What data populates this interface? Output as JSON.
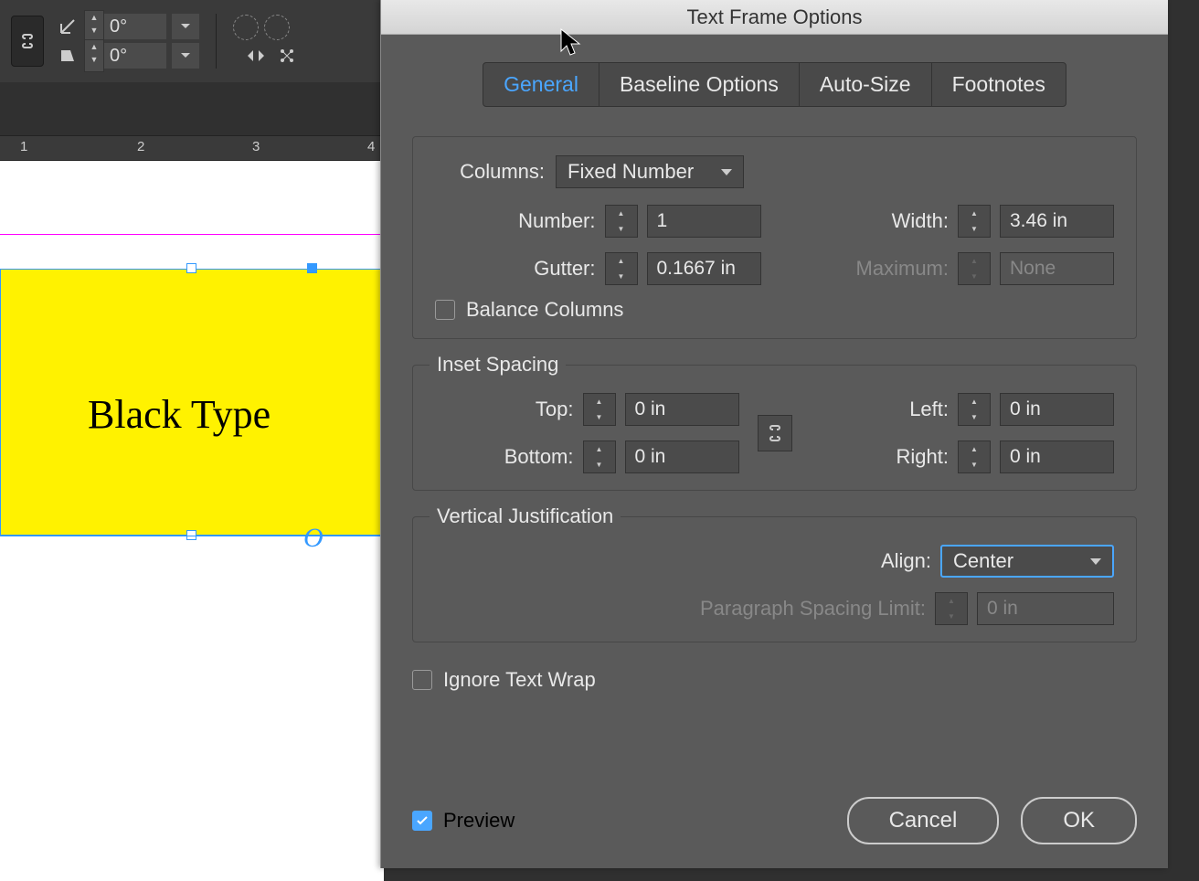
{
  "toolbar": {
    "rotate_value": "0°",
    "shear_value": "0°"
  },
  "ruler": {
    "marks": [
      "1",
      "2",
      "3",
      "4"
    ]
  },
  "canvas": {
    "sample_text": "Black Type",
    "o_mark": "O"
  },
  "dialog": {
    "title": "Text Frame Options",
    "tabs": {
      "general": "General",
      "baseline": "Baseline Options",
      "autosize": "Auto-Size",
      "footnotes": "Footnotes"
    },
    "columns": {
      "label": "Columns:",
      "type": "Fixed Number",
      "number_lbl": "Number:",
      "number": "1",
      "gutter_lbl": "Gutter:",
      "gutter": "0.1667 in",
      "width_lbl": "Width:",
      "width": "3.46 in",
      "max_lbl": "Maximum:",
      "max": "None",
      "balance": "Balance Columns"
    },
    "inset": {
      "legend": "Inset Spacing",
      "top_lbl": "Top:",
      "top": "0 in",
      "bottom_lbl": "Bottom:",
      "bottom": "0 in",
      "left_lbl": "Left:",
      "left": "0 in",
      "right_lbl": "Right:",
      "right": "0 in"
    },
    "vjust": {
      "legend": "Vertical Justification",
      "align_lbl": "Align:",
      "align": "Center",
      "psl_lbl": "Paragraph Spacing Limit:",
      "psl": "0 in"
    },
    "ignorewrap": "Ignore Text Wrap",
    "preview": "Preview",
    "cancel": "Cancel",
    "ok": "OK"
  }
}
